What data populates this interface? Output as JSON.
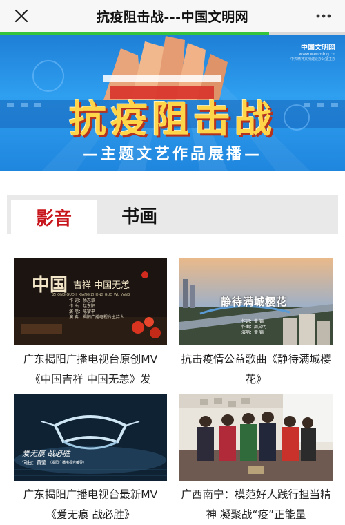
{
  "header": {
    "title": "抗疫阻击战---中国文明网",
    "close_icon": "close-icon",
    "more_icon": "more-dots-icon"
  },
  "progress": {
    "fraction": 0.78,
    "color": "#35c43b"
  },
  "banner": {
    "brand_name": "中国文明网",
    "brand_url": "www.wenming.cn",
    "brand_tagline": "中央精神文明建设办公室主办",
    "title": "抗疫阻击战",
    "subtitle": "—主题文艺作品展播—"
  },
  "tabs": [
    {
      "label": "影音",
      "active": true
    },
    {
      "label": "书画",
      "active": false
    }
  ],
  "cards": [
    {
      "title": "广东揭阳广播电视台原创MV《中国吉祥 中国无恙》发",
      "thumb": {
        "headline": "中国",
        "headline2": "吉祥 中国无恙",
        "pinyin": "ZHONG GUO JI XIANG ZHONG GUO WU YANG",
        "credits": [
          "作 词：杨志章",
          "作 曲：赵东阳",
          "演 唱：陈黎平",
          "演 奏：揭阳广播电视台主持人"
        ]
      }
    },
    {
      "title": "抗击疫情公益歌曲《静待满城樱花》",
      "thumb": {
        "headline": "静待满城樱花",
        "credits": [
          "作词：黄 锦",
          "作曲：周文明",
          "演唱：黄 锦"
        ]
      }
    },
    {
      "title": "广东揭阳广播电视台最新MV《爱无痕 战必胜》",
      "thumb": {
        "headline": "爱无痕 战必胜",
        "credits": [
          "词曲：黄莹",
          "（揭阳广播电视台编导）"
        ]
      }
    },
    {
      "title": "广西南宁：模范好人践行担当精神 凝聚战“疫”正能量",
      "thumb": {}
    }
  ],
  "colors": {
    "accent": "#c8161d",
    "banner_blue": "#2f9ff0",
    "gold": "#ffd54a"
  }
}
